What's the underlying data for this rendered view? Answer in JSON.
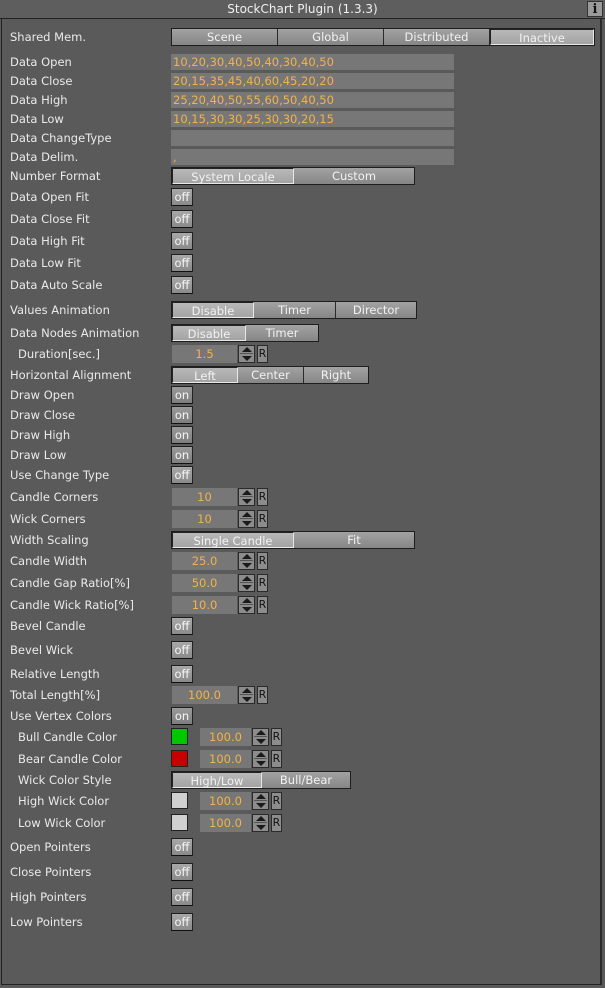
{
  "window": {
    "title": "StockChart Plugin (1.3.3)",
    "info_label": "i"
  },
  "shared_mem": {
    "label": "Shared Mem.",
    "options": [
      "Scene",
      "Global",
      "Distributed",
      "Inactive"
    ],
    "selected": "Inactive"
  },
  "data_fields": [
    {
      "label": "Data Open",
      "value": "10,20,30,40,50,40,30,40,50"
    },
    {
      "label": "Data Close",
      "value": "20,15,35,45,40,60,45,20,20"
    },
    {
      "label": "Data High",
      "value": "25,20,40,50,55,60,50,40,50"
    },
    {
      "label": "Data Low",
      "value": "10,15,30,30,25,30,30,20,15"
    },
    {
      "label": "Data ChangeType",
      "value": ""
    },
    {
      "label": "Data Delim.",
      "value": ","
    }
  ],
  "number_format": {
    "label": "Number Format",
    "options": [
      "System Locale",
      "Custom"
    ],
    "selected": "System Locale"
  },
  "fit_toggles": [
    {
      "label": "Data Open Fit",
      "value": "off"
    },
    {
      "label": "Data Close Fit",
      "value": "off"
    },
    {
      "label": "Data High Fit",
      "value": "off"
    },
    {
      "label": "Data Low Fit",
      "value": "off"
    },
    {
      "label": "Data Auto Scale",
      "value": "off"
    }
  ],
  "values_animation": {
    "label": "Values Animation",
    "options": [
      "Disable",
      "Timer",
      "Director"
    ],
    "selected": "Disable"
  },
  "data_nodes_animation": {
    "label": "Data Nodes Animation",
    "options": [
      "Disable",
      "Timer"
    ],
    "selected": "Disable"
  },
  "duration": {
    "label": "Duration[sec.]",
    "value": "1.5",
    "reset_label": "R"
  },
  "horizontal_alignment": {
    "label": "Horizontal Alignment",
    "options": [
      "Left",
      "Center",
      "Right"
    ],
    "selected": "Left"
  },
  "draw_toggles": [
    {
      "label": "Draw Open",
      "value": "on"
    },
    {
      "label": "Draw Close",
      "value": "on"
    },
    {
      "label": "Draw High",
      "value": "on"
    },
    {
      "label": "Draw Low",
      "value": "on"
    },
    {
      "label": "Use Change Type",
      "value": "off"
    }
  ],
  "candle_corners": {
    "label": "Candle Corners",
    "value": "10",
    "reset_label": "R"
  },
  "wick_corners": {
    "label": "Wick Corners",
    "value": "10",
    "reset_label": "R"
  },
  "width_scaling": {
    "label": "Width Scaling",
    "options": [
      "Single Candle",
      "Fit"
    ],
    "selected": "Single Candle"
  },
  "candle_width": {
    "label": "Candle Width",
    "value": "25.0",
    "reset_label": "R"
  },
  "candle_gap_ratio": {
    "label": "Candle Gap Ratio[%]",
    "value": "50.0",
    "reset_label": "R"
  },
  "candle_wick_ratio": {
    "label": "Candle Wick Ratio[%]",
    "value": "10.0",
    "reset_label": "R"
  },
  "bevel_candle": {
    "label": "Bevel Candle",
    "value": "off"
  },
  "bevel_wick": {
    "label": "Bevel Wick",
    "value": "off"
  },
  "relative_length": {
    "label": "Relative Length",
    "value": "off"
  },
  "total_length": {
    "label": "Total Length[%]",
    "value": "100.0",
    "reset_label": "R"
  },
  "use_vertex_colors": {
    "label": "Use Vertex Colors",
    "value": "on"
  },
  "bull_candle_color": {
    "label": "Bull Candle Color",
    "color": "#00c800",
    "value": "100.0",
    "reset_label": "R"
  },
  "bear_candle_color": {
    "label": "Bear Candle Color",
    "color": "#c80000",
    "value": "100.0",
    "reset_label": "R"
  },
  "wick_color_style": {
    "label": "Wick Color Style",
    "options": [
      "High/Low",
      "Bull/Bear"
    ],
    "selected": "High/Low"
  },
  "high_wick_color": {
    "label": "High Wick Color",
    "color": "#d0d0d0",
    "value": "100.0",
    "reset_label": "R"
  },
  "low_wick_color": {
    "label": "Low Wick Color",
    "color": "#d0d0d0",
    "value": "100.0",
    "reset_label": "R"
  },
  "pointer_toggles": [
    {
      "label": "Open Pointers",
      "value": "off"
    },
    {
      "label": "Close Pointers",
      "value": "off"
    },
    {
      "label": "High Pointers",
      "value": "off"
    },
    {
      "label": "Low Pointers",
      "value": "off"
    }
  ]
}
